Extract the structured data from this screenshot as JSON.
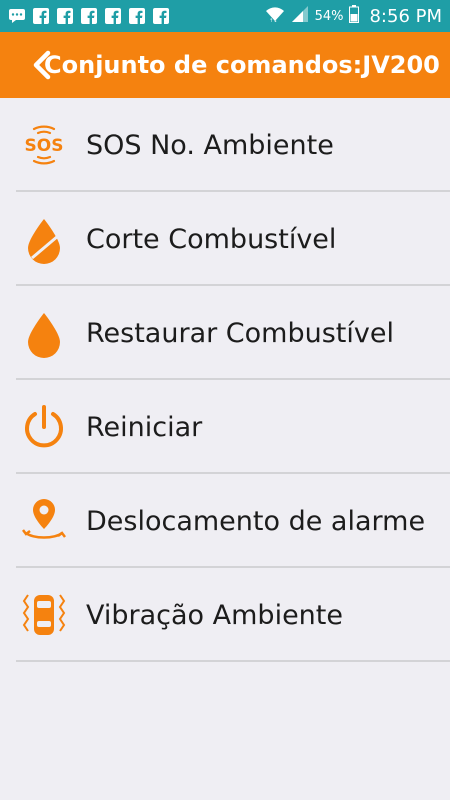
{
  "status_bar": {
    "battery": "54%",
    "time": "8:56 PM"
  },
  "header": {
    "title": "Conjunto de comandos:JV200"
  },
  "commands": [
    {
      "label": "SOS No. Ambiente",
      "icon": "sos-icon"
    },
    {
      "label": "Corte Combustível",
      "icon": "fuel-cut-icon"
    },
    {
      "label": "Restaurar Combustível",
      "icon": "fuel-drop-icon"
    },
    {
      "label": "Reiniciar",
      "icon": "power-icon"
    },
    {
      "label": "Deslocamento de alarme",
      "icon": "location-move-icon"
    },
    {
      "label": "Vibração Ambiente",
      "icon": "car-vibration-icon"
    }
  ],
  "colors": {
    "accent": "#f5820f",
    "status_bar": "#1f9ea6",
    "background": "#efeef3"
  }
}
